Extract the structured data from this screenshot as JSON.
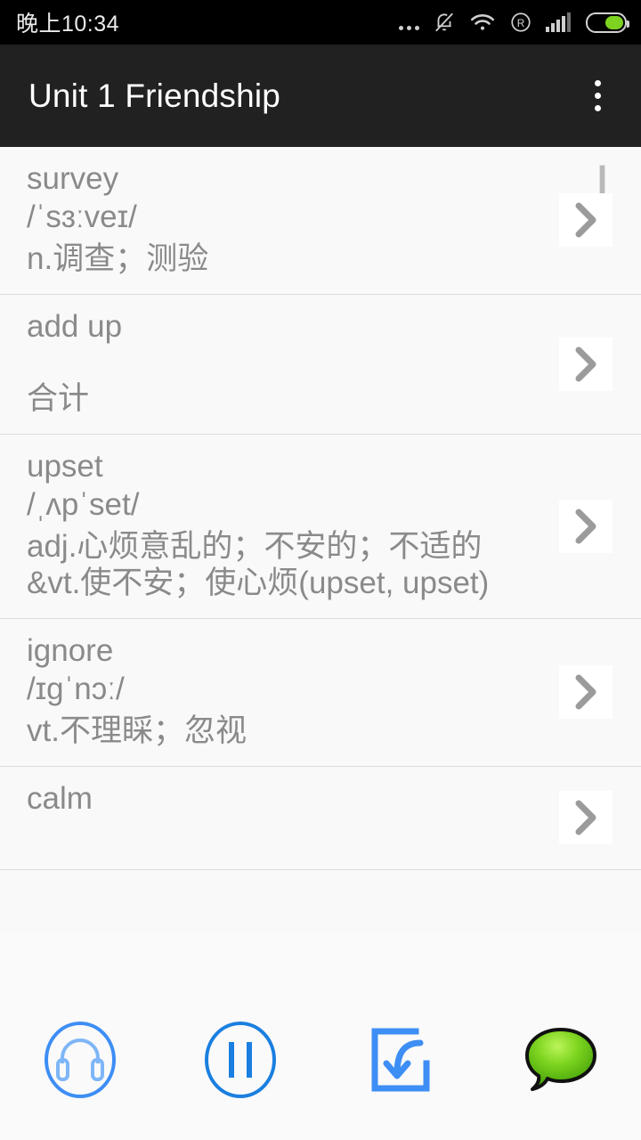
{
  "statusbar": {
    "clock": "晚上10:34",
    "icons": [
      "more-dots-icon",
      "bell-muted-icon",
      "wifi-icon",
      "roaming-r-icon",
      "signal-bars-icon",
      "battery-icon"
    ],
    "battery_level_pct": 52,
    "battery_color": "#7ed321"
  },
  "titlebar": {
    "title": "Unit 1 Friendship",
    "overflow_label": "更多",
    "background": "#212121"
  },
  "list": {
    "scroll_thumb_visible": true,
    "chevron_icon": "chevron-right-icon",
    "items": [
      {
        "word": "survey",
        "phonetic": "/ˈsɜːveɪ/",
        "meaning_lines": [
          "n.调查；测验"
        ]
      },
      {
        "word": "add up",
        "phonetic": "",
        "meaning_lines": [
          "合计"
        ]
      },
      {
        "word": "upset",
        "phonetic": "/ˌʌpˈset/",
        "meaning_lines": [
          "adj.心烦意乱的；不安的；不适的",
          "&vt.使不安；使心烦(upset, upset)"
        ]
      },
      {
        "word": "ignore",
        "phonetic": "/ɪɡˈnɔː/",
        "meaning_lines": [
          "vt.不理睬；忽视"
        ]
      },
      {
        "word": "calm",
        "phonetic": "",
        "meaning_lines": [
          ""
        ]
      }
    ]
  },
  "toolbar": {
    "buttons": [
      {
        "name": "headphones-button",
        "icon": "headphones-circle-icon",
        "label": "听音"
      },
      {
        "name": "pause-button",
        "icon": "pause-circle-icon",
        "label": "暂停"
      },
      {
        "name": "import-button",
        "icon": "import-arrow-icon",
        "label": "导入"
      },
      {
        "name": "chat-button",
        "icon": "green-speech-bubble-icon",
        "label": "消息"
      }
    ],
    "accent_color": "#3d8ef5",
    "bubble_color": "#5cc51c"
  }
}
